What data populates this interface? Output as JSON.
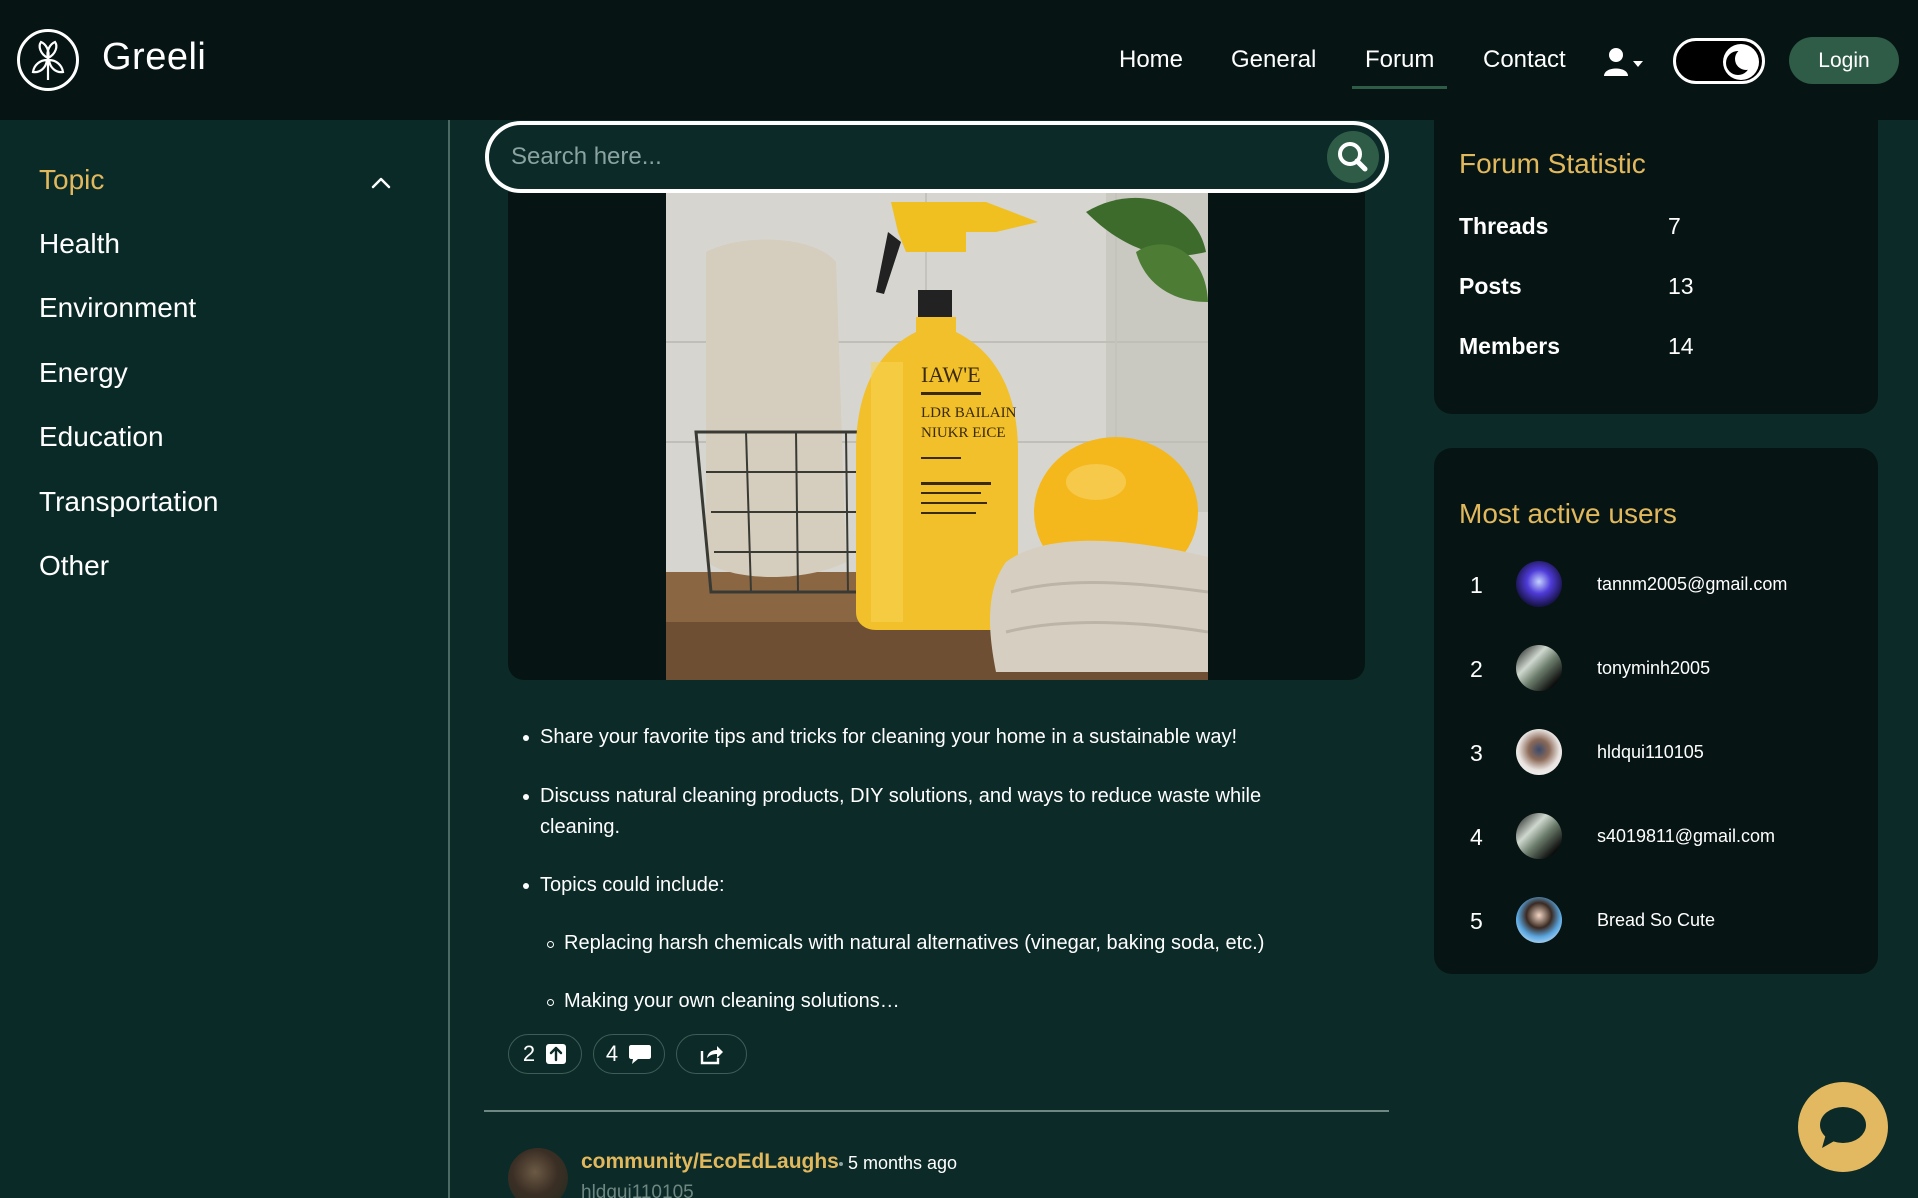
{
  "header": {
    "brand": "Greeli",
    "logo_icon": "leaf-logo-icon",
    "nav": [
      {
        "label": "Home"
      },
      {
        "label": "General"
      },
      {
        "label": "Forum",
        "active": true
      },
      {
        "label": "Contact"
      }
    ],
    "login_label": "Login",
    "theme_toggle": "dark"
  },
  "sidebar": {
    "heading": "Topic",
    "items": [
      {
        "label": "Health"
      },
      {
        "label": "Environment"
      },
      {
        "label": "Energy"
      },
      {
        "label": "Education"
      },
      {
        "label": "Transportation"
      },
      {
        "label": "Other"
      }
    ]
  },
  "search": {
    "placeholder": "Search here..."
  },
  "post": {
    "bullets": [
      "Share your favorite tips and tricks for cleaning your home in a sustainable way!",
      "Discuss natural cleaning products, DIY solutions, and ways to reduce waste while",
      "cleaning.",
      "Topics could include:"
    ],
    "sub_bullets": [
      "Replacing harsh chemicals with natural alternatives (vinegar, baking soda, etc.)",
      "Making your own cleaning solutions…"
    ],
    "upvotes": "2",
    "comments": "4"
  },
  "next_post": {
    "community": "community/EcoEdLaughs",
    "time": "5 months ago",
    "author": "hldqui110105"
  },
  "forum_statistic": {
    "title": "Forum Statistic",
    "rows": [
      {
        "label": "Threads",
        "value": "7"
      },
      {
        "label": "Posts",
        "value": "13"
      },
      {
        "label": "Members",
        "value": "14"
      }
    ]
  },
  "active_users": {
    "title": "Most active users",
    "users": [
      {
        "rank": "1",
        "name": "tannm2005@gmail.com"
      },
      {
        "rank": "2",
        "name": "tonyminh2005"
      },
      {
        "rank": "3",
        "name": "hldqui110105"
      },
      {
        "rank": "4",
        "name": "s4019811@gmail.com"
      },
      {
        "rank": "5",
        "name": "Bread So Cute"
      }
    ]
  },
  "colors": {
    "accent_gold": "#e2b85d",
    "brand_green": "#2f5c47",
    "bg": "#0b2a28",
    "panel": "#061514"
  }
}
